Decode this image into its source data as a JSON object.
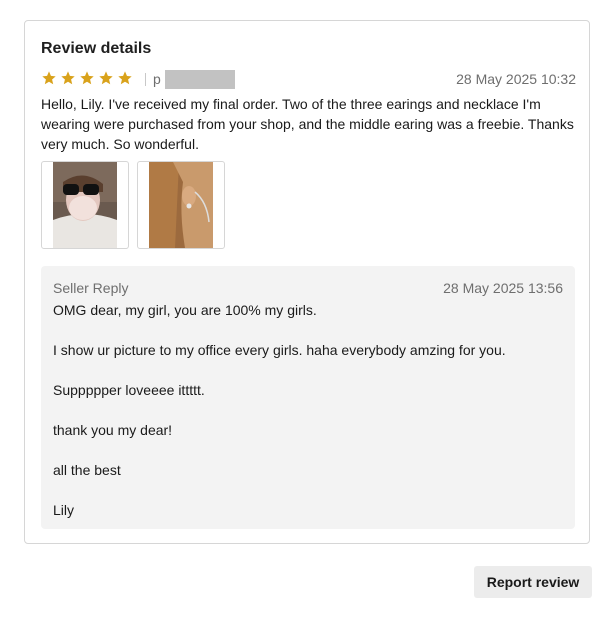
{
  "review": {
    "title": "Review details",
    "rating": 5,
    "reviewer_initial": "p",
    "date": "28 May 2025 10:32",
    "text": "Hello, Lily. I've received my final order. Two of the three earings and necklace I'm wearing were purchased from your shop, and the middle earing was a freebie. Thanks very much. So wonderful.",
    "star_color": "#d9a21b"
  },
  "reply": {
    "label": "Seller Reply",
    "date": "28 May 2025 13:56",
    "lines": [
      "OMG dear, my girl, you are 100% my girls.",
      "I show ur picture to my office every girls. haha everybody amzing for you.",
      "Suppppper loveeee ittttt.",
      "thank you my dear!",
      "all the best",
      "Lily"
    ]
  },
  "actions": {
    "report_label": "Report review"
  }
}
